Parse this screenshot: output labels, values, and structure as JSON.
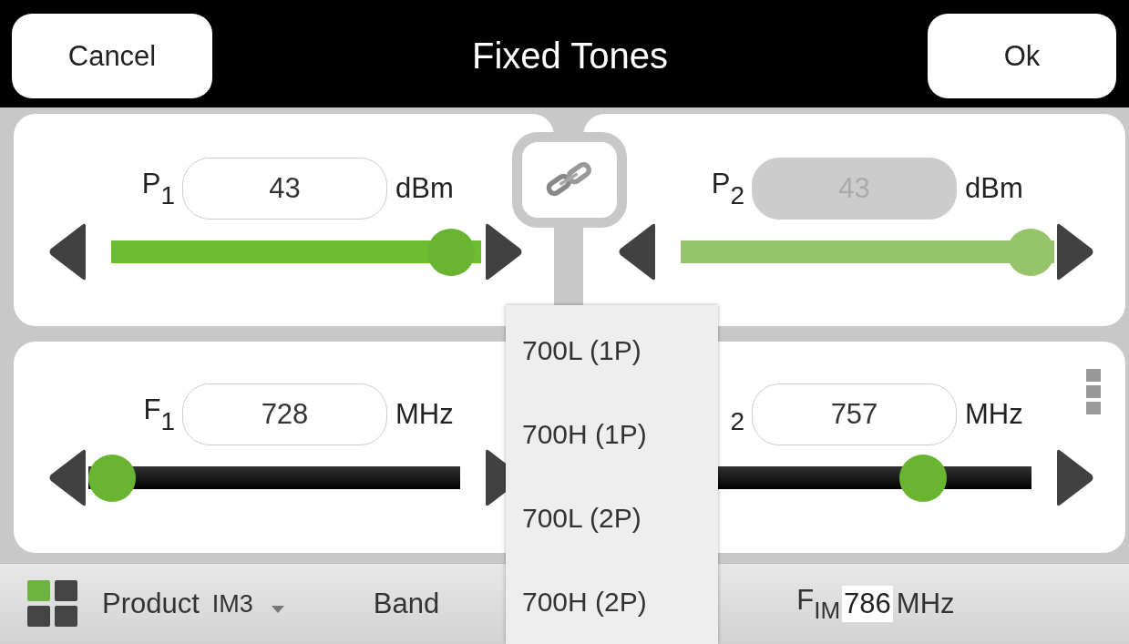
{
  "header": {
    "cancel": "Cancel",
    "title": "Fixed Tones",
    "ok": "Ok"
  },
  "power": {
    "controls": [
      {
        "kind": "power",
        "label": "P",
        "sub": "1",
        "value": "43",
        "unit": "dBm",
        "disabled": false,
        "level": 0.98
      },
      {
        "kind": "power",
        "label": "P",
        "sub": "2",
        "value": "43",
        "unit": "dBm",
        "disabled": true,
        "level": 1
      }
    ]
  },
  "frequency": {
    "controls": [
      {
        "kind": "frequency",
        "label": "F",
        "sub": "1",
        "value": "728",
        "unit": "MHz",
        "disabled": false,
        "left_arrow": true,
        "level": 0
      },
      {
        "kind": "frequency",
        "sub": "2",
        "value": "757",
        "unit": "MHz",
        "disabled": false,
        "left_arrow": false,
        "level": 0.74
      }
    ]
  },
  "dropdown": {
    "items": [
      "700L (1P)",
      "700H (1P)",
      "700L (2P)",
      "700H (2P)"
    ]
  },
  "bottom_bar": {
    "product_label": "Product",
    "product_value": "IM3",
    "band_label": "Band",
    "fim_label": "F",
    "fim_sub": "IM",
    "fim_value": "786",
    "fim_unit": "MHz"
  }
}
